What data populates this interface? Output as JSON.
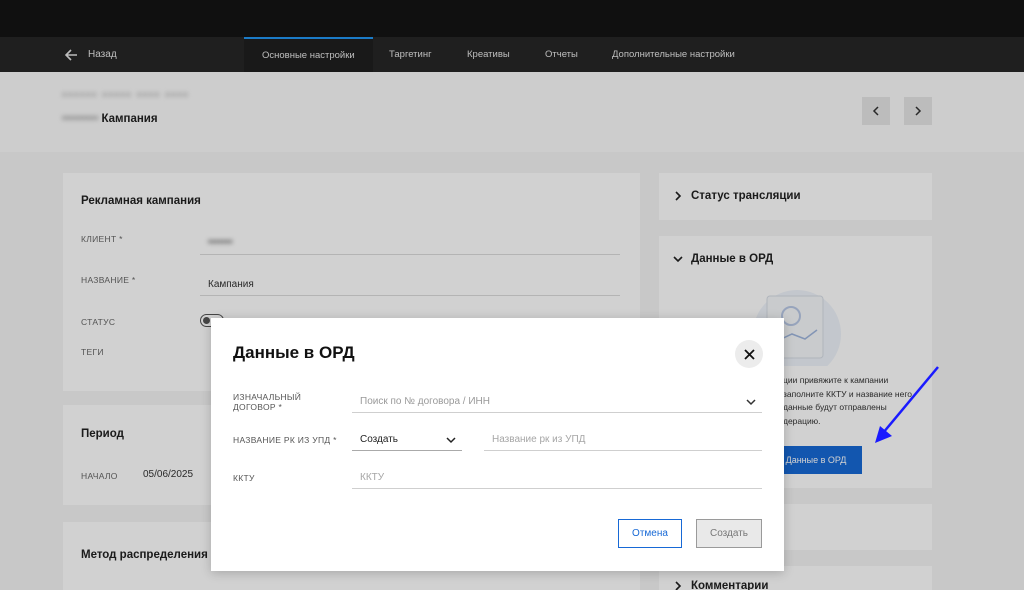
{
  "nav": {
    "back_label": "Назад",
    "tabs": [
      {
        "label": "Основные настройки",
        "active": true
      },
      {
        "label": "Таргетинг"
      },
      {
        "label": "Креативы"
      },
      {
        "label": "Отчеты"
      },
      {
        "label": "Дополнительные настройки"
      }
    ]
  },
  "header": {
    "breadcrumb_blurred": "•••••• ••••• •••• ••••",
    "title_blurred_prefix": "•••••••••",
    "title": "Кампания"
  },
  "campaign_card": {
    "title": "Рекламная кампания",
    "client_label": "КЛИЕНТ *",
    "client_value_blurred": "•••••••",
    "name_label": "НАЗВАНИЕ *",
    "name_value": "Кампания",
    "status_label": "СТАТУС",
    "tags_label": "ТЕГИ"
  },
  "period_card": {
    "title": "Период",
    "start_label": "НАЧАЛО",
    "start_value": "05/06/2025"
  },
  "method_card": {
    "title": "Метод распределения"
  },
  "right_panel": {
    "broadcast_status": "Статус трансляции",
    "ord_title": "Данные в ОРД",
    "ord_text": "ции привяжите к кампании заполните ККТУ и название него данные будут отправлены дерацию.",
    "ord_button": "Данные в ОРД",
    "comments": "Комментарии"
  },
  "modal": {
    "title": "Данные в ОРД",
    "contract_label_line1": "ИЗНАЧАЛЬНЫЙ",
    "contract_label_line2": "ДОГОВОР *",
    "contract_placeholder": "Поиск по № договора / ИНН",
    "rk_label": "НАЗВАНИЕ РК ИЗ УПД *",
    "rk_select_value": "Создать",
    "rk_name_placeholder": "Название рк из УПД",
    "kktu_label": "ККТУ",
    "kktu_placeholder": "ККТУ",
    "cancel_label": "Отмена",
    "create_label": "Создать"
  },
  "colors": {
    "accent": "#1769d6",
    "annotation_arrow": "#1a1aff"
  }
}
